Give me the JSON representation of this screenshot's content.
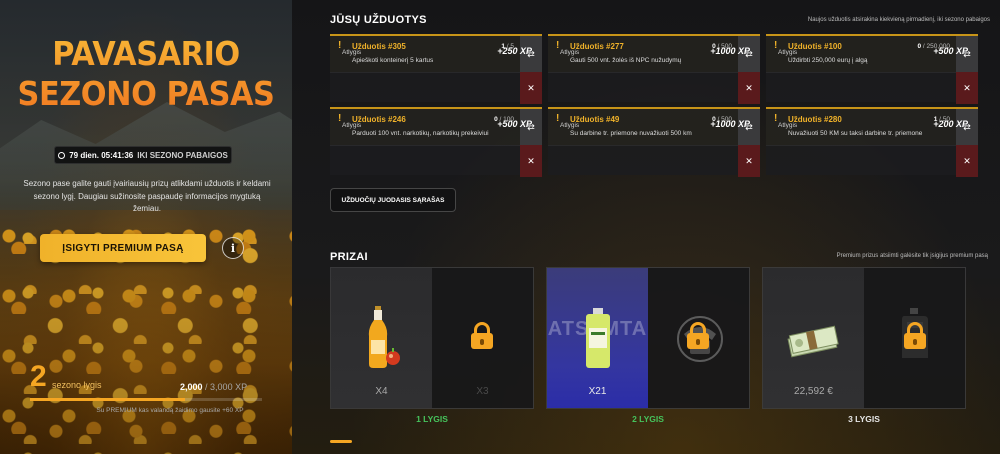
{
  "left": {
    "title_line1": "PAVASARIO",
    "title_line2": "SEZONO PASAS",
    "timer_value": "79 dien. 05:41:36",
    "timer_suffix": "IKI SEZONO PABAIGOS",
    "description": "Sezono pase galite gauti įvairiausių prizų atlikdami užduotis ir keldami sezono lygį. Daugiau sužinosite paspaudę informacijos mygtuką žemiau.",
    "buy_button": "ĮSIGYTI PREMIUM PASĄ",
    "info_icon": "i",
    "level_number": "2",
    "level_label": "sezono lygis",
    "xp_current": "2,000",
    "xp_max": "/ 3,000 XP",
    "xp_progress": 0.6667,
    "footer_note": "Su PREMIUM kas valandą žaidimo gausite +60 XP"
  },
  "tasks_section": {
    "title": "JŪSŲ UŽDUOTYS",
    "note": "Naujos užduotis atsirakina kiekvieną pirmadienį, iki sezono pabaigos",
    "reward_label": "Atlygis",
    "swap_icon": "⇄",
    "close_icon": "✕",
    "tasks": [
      {
        "name": "Užduotis #305",
        "progress_cur": "1",
        "progress_max": "/ 5",
        "desc": "Apieškoti konteinerį 5 kartus",
        "xp": "+250 XP"
      },
      {
        "name": "Užduotis #277",
        "progress_cur": "0",
        "progress_max": "/ 500",
        "desc": "Gauti 500 vnt. žolės iš NPC nužudymų",
        "xp": "+1000 XP"
      },
      {
        "name": "Užduotis #100",
        "progress_cur": "0",
        "progress_max": "/ 250,000",
        "desc": "Uždirbti 250,000 eurų į algą",
        "xp": "+500 XP"
      },
      {
        "name": "Užduotis #246",
        "progress_cur": "0",
        "progress_max": "/ 100",
        "desc": "Parduoti 100 vnt. narkotikų, narkotikų prekeiviui",
        "xp": "+500 XP"
      },
      {
        "name": "Užduotis #49",
        "progress_cur": "0",
        "progress_max": "/ 500",
        "desc": "Su darbine tr. priemone nuvažiuoti 500 km",
        "xp": "+1000 XP"
      },
      {
        "name": "Užduotis #280",
        "progress_cur": "1",
        "progress_max": "/ 50",
        "desc": "Nuvažiuoti 50 KM su taksi darbine tr. priemone",
        "xp": "+200 XP"
      }
    ],
    "list_button": "UŽDUOČIŲ JUODASIS SĄRAŠAS"
  },
  "prizes_section": {
    "title": "PRIZAI",
    "note": "Premium prizus atsiimti galėsite tik įsigijus premium pasą",
    "claimed_text": "ATSIIMTA",
    "prizes": [
      {
        "free_count": "X4",
        "premium_count": "X3",
        "level": "1 LYGIS",
        "free_item": "cider-bottle-icon",
        "premium_item": "locked-item"
      },
      {
        "free_count": "X21",
        "premium_count": "",
        "level": "2 LYGIS",
        "free_item": "chemical-jug-icon",
        "premium_item": "phone-icon"
      },
      {
        "free_count": "22,592 €",
        "premium_count": "",
        "level": "3 LYGIS",
        "free_item": "cash-stack-icon",
        "premium_item": "jerrycan-icon"
      }
    ]
  },
  "colors": {
    "accent": "#f5a623",
    "green": "#46c35c",
    "claimed": "#3436a0",
    "close_bg": "#5a1a1c"
  }
}
